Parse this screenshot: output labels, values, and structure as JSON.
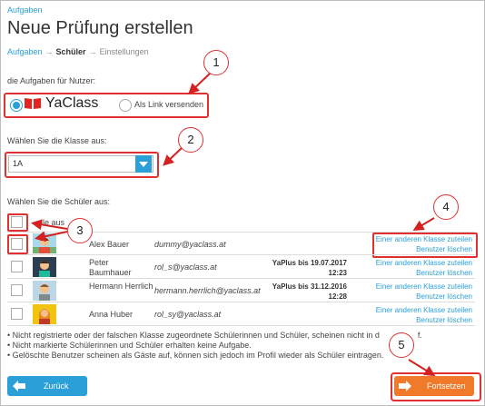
{
  "breadcrumb_top": "Aufgaben",
  "page_title": "Neue Prüfung erstellen",
  "steps": {
    "step1": "Aufgaben",
    "step2": "Schüler",
    "step3": "Einstellungen"
  },
  "assign_label": "die Aufgaben für Nutzer:",
  "radio_options": {
    "yaclass": "YaClass",
    "link": "Als Link versenden"
  },
  "class_label": "Wählen Sie die Klasse aus:",
  "class_value": "1A",
  "students_label": "Wählen Sie die Schüler aus:",
  "select_all": "alle aus",
  "students": [
    {
      "name": "Alex Bauer",
      "email": "dummy@yaclass.at",
      "plus": "",
      "plus_date": "",
      "action1": "Einer anderen Klasse zuteilen",
      "action2": "Benutzer löschen"
    },
    {
      "name": "Peter Baumhauer",
      "email": "rol_s@yaclass.at",
      "plus": "YaPlus bis 19.07.2017",
      "plus_date": "12:23",
      "action1": "Einer anderen Klasse zuteilen",
      "action2": "Benutzer löschen"
    },
    {
      "name": "Hermann Herrlich",
      "email": "hermann.herrlich@yaclass.at",
      "plus": "YaPlus bis 31.12.2016",
      "plus_date": "12:28",
      "action1": "Einer anderen Klasse zuteilen",
      "action2": "Benutzer löschen"
    },
    {
      "name": "Anna Huber",
      "email": "rol_sy@yaclass.at",
      "plus": "",
      "plus_date": "",
      "action1": "Einer anderen Klasse zuteilen",
      "action2": "Benutzer löschen"
    }
  ],
  "notes": [
    "Nicht registrierte oder der falschen Klasse zugeordnete Schülerinnen und Schüler, scheinen nicht in d",
    "Nicht markierte Schülerinnen und Schüler erhalten keine Aufgabe.",
    "Gelöschte Benutzer scheinen als Gäste auf, können sich jedoch im Profil wieder als Schüler eintragen."
  ],
  "notes_tail": "f.",
  "buttons": {
    "back": "Zurück",
    "next": "Fortsetzen"
  },
  "callouts": [
    "1",
    "2",
    "3",
    "4",
    "5"
  ],
  "colors": {
    "accent": "#2a9fd8",
    "next": "#f07a2a",
    "highlight": "#e03030"
  }
}
